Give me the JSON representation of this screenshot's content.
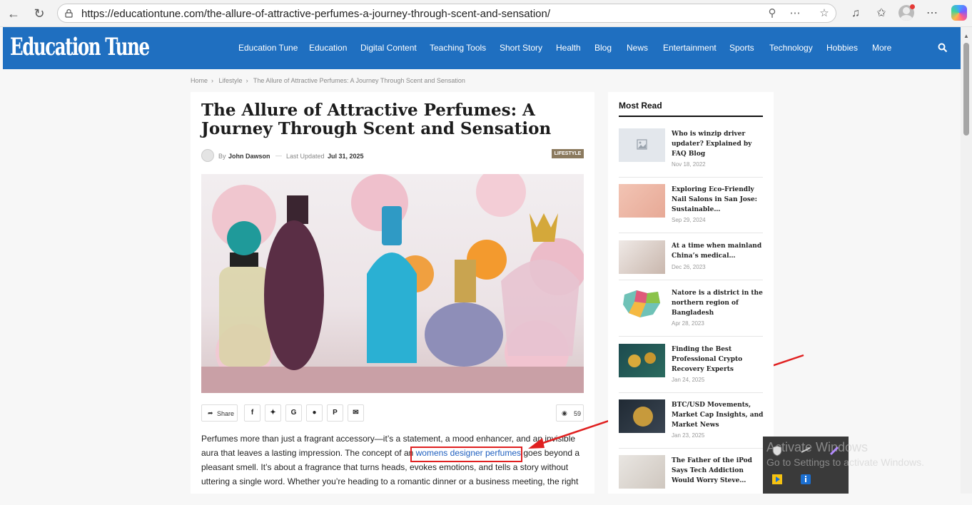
{
  "browser": {
    "url": "https://educationtune.com/the-allure-of-attractive-perfumes-a-journey-through-scent-and-sensation/"
  },
  "site": {
    "logo": "Education Tune",
    "menu": [
      "Education Tune",
      "Education",
      "Digital Content",
      "Teaching Tools",
      "Short Story",
      "Health",
      "Blog",
      "News",
      "Entertainment",
      "Sports",
      "Technology",
      "Hobbies",
      "More"
    ]
  },
  "breadcrumb": [
    "Home",
    "Lifestyle",
    "The Allure of Attractive Perfumes: A Journey Through Scent and Sensation"
  ],
  "article": {
    "title": "The Allure of Attractive Perfumes: A Journey Through Scent and Sensation",
    "by": "By",
    "author": "John Dawson",
    "updated_label": "Last Updated",
    "date": "Jul 31, 2025",
    "category": "LIFESTYLE",
    "share_label": "Share",
    "views": "59",
    "body_before_link": "Perfumes more than just a fragrant accessory—it’s a statement, a mood enhancer, and an invisible aura that leaves a lasting impression. The concept of an ",
    "link_text": "womens designer perfumes",
    "body_after_link": " goes beyond a pleasant smell. It’s about a fragrance that turns heads, evokes emotions, and tells a story without uttering a single word. Whether you’re heading to a romantic dinner or a business meeting, the right"
  },
  "sidebar": {
    "heading": "Most Read",
    "items": [
      {
        "title": "Who is winzip driver updater? Explained by FAQ Blog",
        "date": "Nov 18, 2022"
      },
      {
        "title": "Exploring Eco-Friendly Nail Salons in San Jose: Sustainable…",
        "date": "Sep 29, 2024"
      },
      {
        "title": "At a time when mainland China’s medical…",
        "date": "Dec 26, 2023"
      },
      {
        "title": "Natore is a district in the northern region of Bangladesh",
        "date": "Apr 28, 2023"
      },
      {
        "title": "Finding the Best Professional Crypto Recovery Experts",
        "date": "Jan 24, 2025"
      },
      {
        "title": "BTC/USD Movements, Market Cap Insights, and Market News",
        "date": "Jan 23, 2025"
      },
      {
        "title": "The Father of the iPod Says Tech Addiction Would Worry Steve…",
        "date": ""
      }
    ]
  },
  "overlay": {
    "line1": "Activate Windows",
    "line2": "Go to Settings to activate Windows."
  },
  "colors": {
    "header": "#1f6fc0",
    "accent": "#1f5fbf",
    "badge": "#8b7a5e",
    "annotation": "#e02020"
  }
}
